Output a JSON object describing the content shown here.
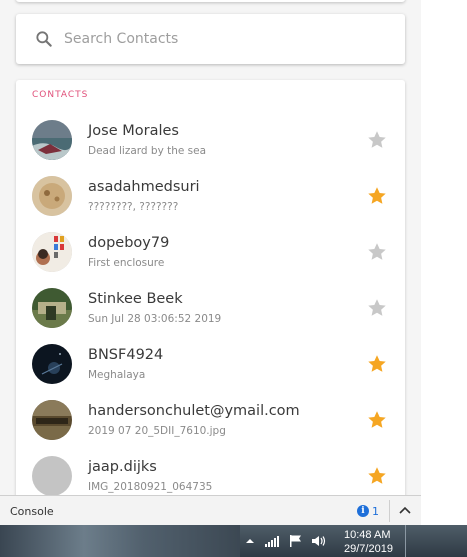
{
  "search": {
    "placeholder": "Search Contacts"
  },
  "contacts_section": {
    "title": "CONTACTS",
    "items": [
      {
        "name": "Jose Morales",
        "subtitle": "Dead lizard by the sea",
        "starred": false
      },
      {
        "name": "asadahmedsuri",
        "subtitle": "????????, ???????",
        "starred": true
      },
      {
        "name": "dopeboy79",
        "subtitle": "First enclosure",
        "starred": false
      },
      {
        "name": "Stinkee Beek",
        "subtitle": "Sun Jul 28 03:06:52 2019",
        "starred": false
      },
      {
        "name": "BNSF4924",
        "subtitle": "Meghalaya",
        "starred": true
      },
      {
        "name": "handersonchulet@ymail.com",
        "subtitle": "2019 07 20_5DII_7610.jpg",
        "starred": true
      },
      {
        "name": "jaap.dijks",
        "subtitle": "IMG_20180921_064735",
        "starred": true
      }
    ]
  },
  "console": {
    "label": "Console",
    "info_count": "1"
  },
  "taskbar": {
    "time": "10:48 AM",
    "date": "29/7/2019"
  },
  "colors": {
    "accent_pink": "#e0507a",
    "star_on": "#f5a623",
    "star_off": "#c8c8c8",
    "info_blue": "#1e6fd9"
  }
}
